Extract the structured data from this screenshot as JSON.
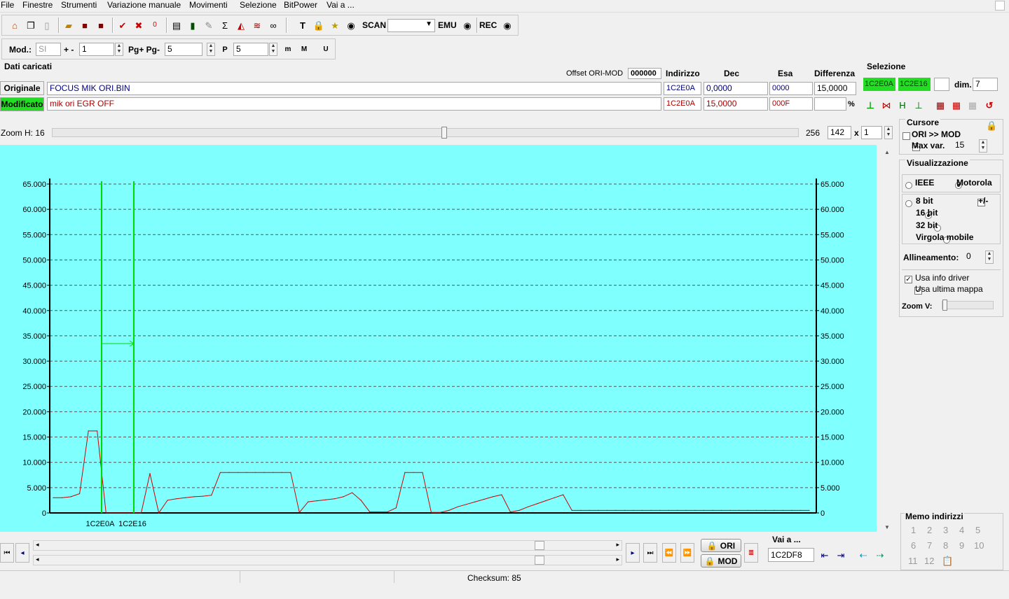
{
  "menu": [
    "File",
    "Finestre",
    "Strumenti",
    "Variazione manuale",
    "Movimenti",
    "Selezione",
    "BitPower",
    "Vai a ..."
  ],
  "toolbar": {
    "scan_label": "SCAN",
    "emu_label": "EMU",
    "rec_label": "REC",
    "mod_label": "Mod.:",
    "mod_value": "SI",
    "plusminus_label": "+ -",
    "plusminus_value": "1",
    "pg_label": "Pg+ Pg-",
    "pg_value": "5",
    "p_value": "5"
  },
  "data": {
    "section_title": "Dati caricati",
    "offset_label": "Offset ORI-MOD",
    "offset_value": "000000",
    "col_indirizzo": "Indirizzo",
    "col_dec": "Dec",
    "col_esa": "Esa",
    "col_diff": "Differenza",
    "orig": {
      "label": "Originale",
      "file": "FOCUS MIK ORI.BIN",
      "addr": "1C2E0A",
      "dec": "0,0000",
      "esa": "0000",
      "diff": "15,0000"
    },
    "mod": {
      "label": "Modificato",
      "file": "mik ori EGR OFF",
      "addr": "1C2E0A",
      "dec": "15,0000",
      "esa": "000F",
      "diff": "",
      "pct": "%"
    }
  },
  "selezione": {
    "title": "Selezione",
    "start": "1C2E0A",
    "end": "1C2E16",
    "dim_label": "dim.",
    "dim_value": "7"
  },
  "zoom": {
    "label": "Zoom H: 16",
    "value_256": "256",
    "value_142": "142",
    "x_label": "x",
    "value_1": "1"
  },
  "cursore": {
    "title": "Cursore",
    "ori_mod_label": "ORI >> MOD",
    "max_var_label": "Max var.",
    "max_var_value": "15"
  },
  "visualizzazione": {
    "title": "Visualizzazione",
    "ieee": "IEEE",
    "motorola": "Motorola",
    "bit8": "8 bit",
    "plusminus": "+/-",
    "bit16": "16 bit",
    "bit32": "32 bit",
    "virgola": "Virgola mobile",
    "allineamento_label": "Allineamento:",
    "allineamento_value": "0",
    "usa_info_driver": "Usa info driver",
    "usa_ultima_mappa": "Usa ultima mappa",
    "zoom_v_label": "Zoom V:"
  },
  "memo": {
    "title": "Memo indirizzi",
    "numbers": [
      "1",
      "2",
      "3",
      "4",
      "5",
      "6",
      "7",
      "8",
      "9",
      "10",
      "11",
      "12"
    ]
  },
  "bottom": {
    "ori_btn": "ORI",
    "mod_btn": "MOD",
    "vai_a_label": "Vai a ...",
    "vai_a_value": "1C2DF8",
    "checksum": "Checksum: 85"
  },
  "colors": {
    "chart_bg": "#80ffff",
    "series_line": "#cc0000",
    "cursor_line": "#00dd00",
    "selection_green": "#22dd22"
  },
  "chart_data": {
    "type": "line",
    "ylim": [
      0,
      65000
    ],
    "yticks": [
      "0",
      "5.000",
      "10.000",
      "15.000",
      "20.000",
      "25.000",
      "30.000",
      "35.000",
      "40.000",
      "45.000",
      "50.000",
      "55.000",
      "60.000",
      "65.000"
    ],
    "x_markers": [
      "1C2E0A",
      "1C2E16"
    ],
    "grid": true,
    "series": [
      {
        "values": [
          3000,
          3000,
          3200,
          3800,
          16200,
          16200,
          0,
          0,
          0,
          0,
          0,
          7800,
          0,
          2500,
          2800,
          3000,
          3200,
          3300,
          3500,
          8000,
          8000,
          8000,
          8000,
          8000,
          8000,
          8000,
          8000,
          8000,
          100,
          2200,
          2400,
          2600,
          2800,
          3200,
          4000,
          2500,
          200,
          200,
          200,
          1000,
          8000,
          8000,
          8000,
          100,
          100,
          500,
          1200,
          1700,
          2200,
          2700,
          3200,
          3600,
          200,
          500,
          1200,
          1800,
          2400,
          3000,
          3600,
          500,
          500,
          500,
          500,
          500,
          500,
          500,
          500,
          500,
          500,
          500,
          500,
          500,
          500,
          500,
          500,
          500,
          500,
          500,
          500,
          500,
          500,
          500,
          500,
          500,
          500,
          500,
          500
        ]
      }
    ]
  }
}
